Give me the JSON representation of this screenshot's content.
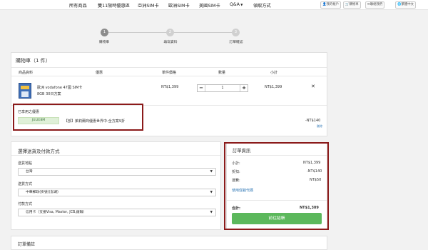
{
  "nav": {
    "items": [
      "所有商品",
      "雙11限時優惠區",
      "亞洲SIM卡",
      "歐洲SIM卡",
      "美國SIM卡",
      "Q&A",
      "領取方式"
    ]
  },
  "toolbar": {
    "btn1": "我的帳戶",
    "btn2": "購物車",
    "btn3": "聯絡我們",
    "btn4": "繁體中文"
  },
  "steps": [
    {
      "num": "1",
      "label": "購物車"
    },
    {
      "num": "2",
      "label": "填寫資料"
    },
    {
      "num": "3",
      "label": "訂單確認"
    }
  ],
  "cart": {
    "title": "購物車（1 件）",
    "headers": {
      "product": "商品資料",
      "discount": "優惠",
      "unit_price": "單件價格",
      "quantity": "數量",
      "subtotal": "小計"
    },
    "item": {
      "name_line1": "歐洲 vodafone 47國 SIM卡",
      "name_line2": "8GB 30日方案",
      "unit_price": "NT$1,399",
      "qty": "1",
      "subtotal": "NT$1,399"
    },
    "applied_label": "已享用之優惠",
    "coupon_code": "JULIE8M",
    "coupon_desc": "【部】茱莉爾商優惠世界中-全方案9折",
    "coupon_amount": "-NT$140",
    "coupon_remove": "刪除"
  },
  "shipping": {
    "title": "選擇送貨及付款方式",
    "region_label": "送貨地點",
    "region_value": "台灣",
    "method_label": "送貨方式",
    "method_value": "中華郵政(掛號)(澎湖)",
    "payment_label": "付款方式",
    "payment_value": "信用卡（支援Visa, Master, JCB,銀聯）"
  },
  "summary": {
    "title": "訂單資訊",
    "subtotal_label": "小計:",
    "subtotal_value": "NT$1,399",
    "discount_label": "折扣:",
    "discount_value": "-NT$140",
    "shipping_label": "運費:",
    "shipping_value": "NT$50",
    "promo_link": "使用促銷代碼",
    "total_label": "合計:",
    "total_value": "NT$1,309",
    "checkout_label": "前往結帳"
  },
  "footer": {
    "partial_label": "訂單備註"
  },
  "colors": {
    "accent_green": "#5cb85c",
    "highlight_red": "#8b1a1a",
    "coupon_bg": "#dff0d8"
  }
}
